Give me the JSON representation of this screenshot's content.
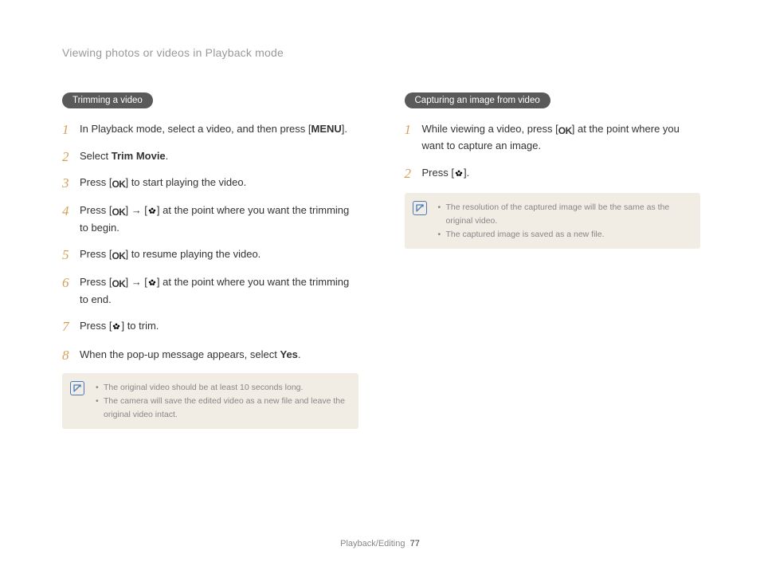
{
  "header": "Viewing photos or videos in Playback mode",
  "left": {
    "pill": "Trimming a video",
    "steps": [
      {
        "pre": "In Playback mode, select a video, and then press [",
        "bold": "MENU",
        "post": "]."
      },
      {
        "pre": "Select ",
        "bold": "Trim Movie",
        "post": "."
      },
      {
        "pre": "Press [",
        "icon1": "OK",
        "mid": "] to start playing the video.",
        "post": ""
      },
      {
        "pre": "Press [",
        "icon1": "OK",
        "mid": "] → [",
        "icon2": "flower",
        "post": "] at the point where you want the trimming to begin."
      },
      {
        "pre": "Press [",
        "icon1": "OK",
        "mid": "] to resume playing the video.",
        "post": ""
      },
      {
        "pre": "Press [",
        "icon1": "OK",
        "mid": "] → [",
        "icon2": "flower",
        "post": "] at the point where you want the trimming to end."
      },
      {
        "pre": "Press [",
        "icon1": "flower",
        "mid": "] to trim.",
        "post": ""
      },
      {
        "pre": "When the pop-up message appears, select ",
        "bold": "Yes",
        "post": "."
      }
    ],
    "notes": [
      "The original video should be at least 10 seconds long.",
      "The camera will save the edited video as a new file and leave the original video intact."
    ]
  },
  "right": {
    "pill": "Capturing an image from video",
    "steps": [
      {
        "pre": "While viewing a video, press [",
        "icon1": "OK",
        "mid": "] at the point where you want to capture an image.",
        "post": ""
      },
      {
        "pre": "Press [",
        "icon1": "flower",
        "mid": "].",
        "post": ""
      }
    ],
    "notes": [
      "The resolution of the captured image will be the same as the original video.",
      "The captured image is saved as a new file."
    ]
  },
  "footer": {
    "section": "Playback/Editing",
    "page": "77"
  }
}
